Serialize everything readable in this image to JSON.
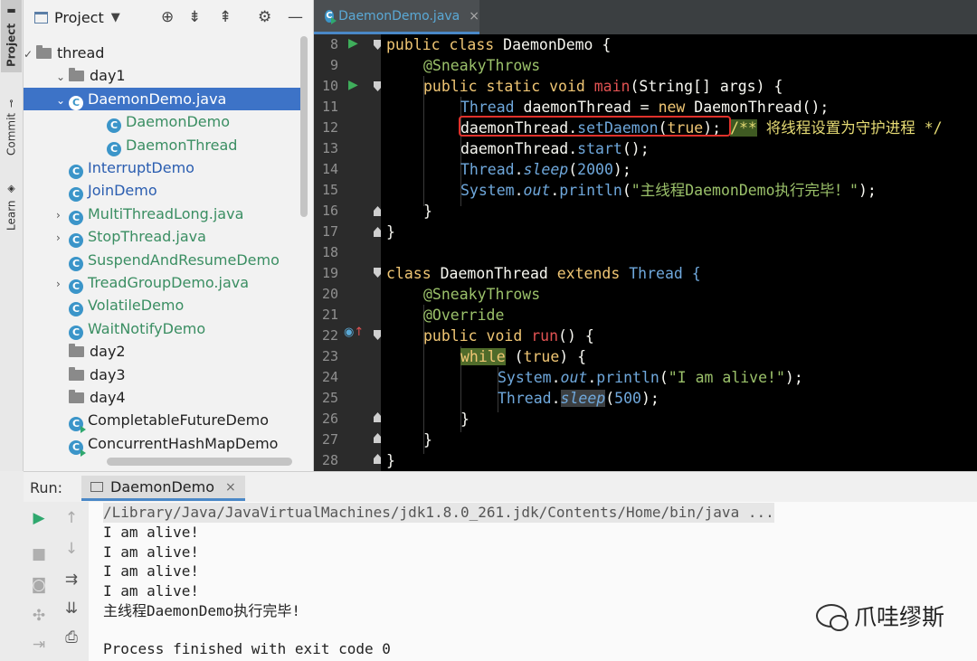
{
  "sidebar_tabs": {
    "project": "Project",
    "commit": "Commit",
    "learn": "Learn"
  },
  "project_panel": {
    "title": "Project",
    "tree": [
      {
        "label": "thread",
        "kind": "folder",
        "indent": 0,
        "arrow": "✓"
      },
      {
        "label": "day1",
        "kind": "folder",
        "indent": 1,
        "arrow": "⌄"
      },
      {
        "label": "DaemonDemo.java",
        "kind": "file",
        "indent": 2,
        "arrow": "⌄",
        "selected": true
      },
      {
        "label": "DaemonDemo",
        "kind": "class",
        "indent": 3,
        "color": "green"
      },
      {
        "label": "DaemonThread",
        "kind": "class",
        "indent": 3,
        "color": "green"
      },
      {
        "label": "InterruptDemo",
        "kind": "class",
        "indent": 2,
        "color": "blue"
      },
      {
        "label": "JoinDemo",
        "kind": "class",
        "indent": 2,
        "color": "blue"
      },
      {
        "label": "MultiThreadLong.java",
        "kind": "file",
        "indent": 2,
        "arrow": "›",
        "color": "green"
      },
      {
        "label": "StopThread.java",
        "kind": "file",
        "indent": 2,
        "arrow": "›",
        "color": "green"
      },
      {
        "label": "SuspendAndResumeDemo",
        "kind": "class",
        "indent": 2,
        "color": "green"
      },
      {
        "label": "TreadGroupDemo.java",
        "kind": "file",
        "indent": 2,
        "arrow": "›",
        "color": "green"
      },
      {
        "label": "VolatileDemo",
        "kind": "class",
        "indent": 2,
        "color": "green"
      },
      {
        "label": "WaitNotifyDemo",
        "kind": "class",
        "indent": 2,
        "color": "green"
      },
      {
        "label": "day2",
        "kind": "folder",
        "indent": 1
      },
      {
        "label": "day3",
        "kind": "folder",
        "indent": 1
      },
      {
        "label": "day4",
        "kind": "folder",
        "indent": 1
      },
      {
        "label": "CompletableFutureDemo",
        "kind": "class",
        "indent": 1
      },
      {
        "label": "ConcurrentHashMapDemo",
        "kind": "class",
        "indent": 1
      }
    ]
  },
  "editor": {
    "tab": "DaemonDemo.java",
    "line_numbers": [
      "8",
      "9",
      "10",
      "11",
      "12",
      "13",
      "14",
      "15",
      "16",
      "17",
      "18",
      "19",
      "20",
      "21",
      "22",
      "23",
      "24",
      "25",
      "26",
      "27",
      "28"
    ],
    "lines": {
      "l8": {
        "kw1": "public class",
        "rest": " DaemonDemo {"
      },
      "l9": {
        "an": "@SneakyThrows"
      },
      "l10": {
        "kw1": "public static void",
        "fn": "main",
        "p": "(String[] args) {"
      },
      "l11": {
        "ty": "Thread",
        "bold": " daemonThread",
        "eq": " = ",
        "kw": "new",
        "rest": " DaemonThread();"
      },
      "l12": {
        "a": "daemonThread",
        "b": ".",
        "c": "setDaemon",
        "d": "(",
        "e": "true",
        "f": ");",
        "cm1": "/**",
        "cm2": " 将线程设置为守护进程 */"
      },
      "l13": {
        "a": "daemonThread",
        "b": ".",
        "c": "start",
        "d": "();"
      },
      "l14": {
        "ty": "Thread",
        "dot": ".",
        "it": "sleep",
        "p1": "(",
        "nm": "2000",
        "p2": ");"
      },
      "l15": {
        "ty": "System",
        "dot": ".",
        "it": "out",
        "dot2": ".",
        "m": "println",
        "p1": "(",
        "st": "\"主线程DaemonDemo执行完毕！\"",
        "p2": ");"
      },
      "l16": {
        "t": "}"
      },
      "l17": {
        "t": "}"
      },
      "l19": {
        "kw1": "class",
        "rest": " DaemonThread ",
        "kw2": "extends",
        "rest2": " Thread {"
      },
      "l20": {
        "an": "@SneakyThrows"
      },
      "l21": {
        "an": "@Override"
      },
      "l22": {
        "kw1": "public void",
        "fn": "run",
        "p": "() {"
      },
      "l23": {
        "hl": "while",
        "p1": " (",
        "kw": "true",
        "p2": ") {"
      },
      "l24": {
        "ty": "System",
        "dot": ".",
        "it": "out",
        "dot2": ".",
        "m": "println",
        "p1": "(",
        "st": "\"I am alive!\"",
        "p2": ");"
      },
      "l25": {
        "ty": "Thread",
        "dot": ".",
        "it": "sleep",
        "p1": "(",
        "nm": "500",
        "p2": ");"
      },
      "l26": {
        "t": "}"
      },
      "l27": {
        "t": "}"
      },
      "l28": {
        "t": "}"
      }
    }
  },
  "run_panel": {
    "label": "Run:",
    "tab": "DaemonDemo",
    "output": [
      "/Library/Java/JavaVirtualMachines/jdk1.8.0_261.jdk/Contents/Home/bin/java ...",
      "I am alive!",
      "I am alive!",
      "I am alive!",
      "I am alive!",
      "主线程DaemonDemo执行完毕!",
      "",
      "Process finished with exit code 0"
    ]
  },
  "watermark": {
    "text": "爪哇缪斯"
  },
  "colors": {
    "highlight_box": "#e0312b",
    "selection": "#3d73c7",
    "run_green": "#2fa86e"
  },
  "icons": [
    "project-folder-icon",
    "crosshair-icon",
    "expand-icon",
    "collapse-icon",
    "gear-icon",
    "minimize-icon",
    "run-icon",
    "stop-icon",
    "camera-icon",
    "rerun-icon",
    "up-icon",
    "down-icon",
    "wrap-icon",
    "scroll-end-icon",
    "print-icon",
    "exit-icon",
    "wechat-icon"
  ]
}
